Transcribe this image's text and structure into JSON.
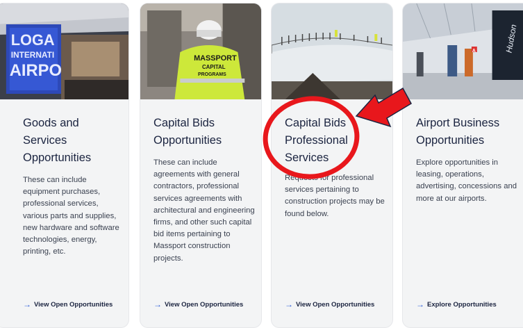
{
  "cards": [
    {
      "title_lines": [
        "Goods and",
        "Services",
        "Opportunities"
      ],
      "description": "These can include equipment purchases, professional services, various parts and supplies, new hardware and software technologies, energy, printing, etc.",
      "link_label": "View Open Opportunities",
      "image_text": [
        "LOGA",
        "INTERNATI",
        "AIRPO"
      ]
    },
    {
      "title_lines": [
        "Capital Bids",
        "Opportunities"
      ],
      "description": "These can include agreements with general contractors, professional services agreements with architectural and engineering firms, and other such capital bid items pertaining to Massport construction projects.",
      "link_label": "View Open Opportunities",
      "image_text": [
        "MASSPORT",
        "CAPITAL",
        "PROGRAMS"
      ]
    },
    {
      "title_lines": [
        "Capital Bids",
        "Professional",
        "Services"
      ],
      "description": "Requests for professional services pertaining to construction projects may be found below.",
      "link_label": "View Open Opportunities"
    },
    {
      "title_lines": [
        "Airport Business",
        "Opportunities"
      ],
      "description": "Explore opportunities in leasing, operations, advertising, concessions and more at our airports.",
      "link_label": "Explore Opportunities",
      "image_text": [
        "Hudson",
        "A"
      ]
    }
  ],
  "icons": {
    "link_arrow": "arrow-right-icon"
  },
  "colors": {
    "title": "#1b2440",
    "annotation_red": "#e8171c",
    "link_arrow": "#2a5bd7"
  }
}
